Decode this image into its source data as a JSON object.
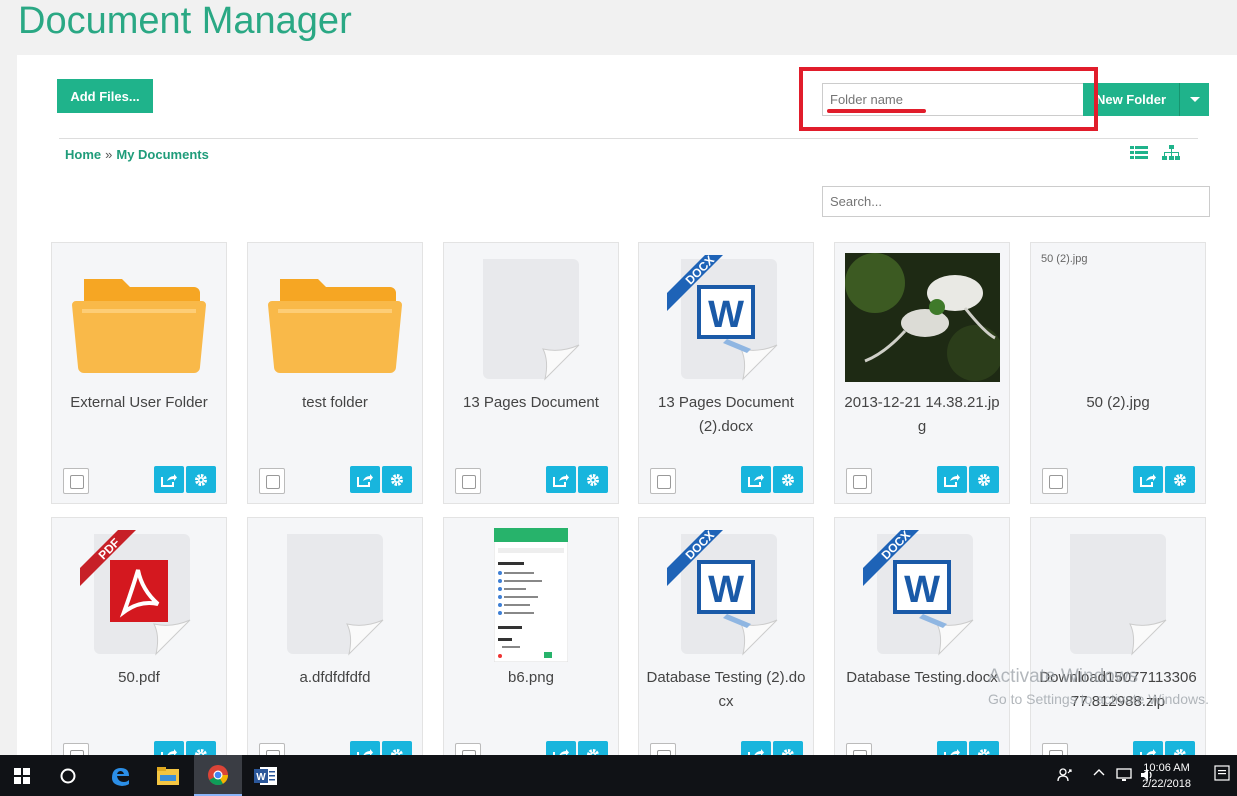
{
  "page_title": "Document Manager",
  "toolbar": {
    "add_files_label": "Add Files...",
    "folder_name_placeholder": "Folder name",
    "new_folder_label": "New Folder"
  },
  "breadcrumb": {
    "home": "Home",
    "separator": "»",
    "current": "My Documents"
  },
  "search": {
    "placeholder": "Search..."
  },
  "files": [
    {
      "name": "External User Folder",
      "icon": "folder-icon"
    },
    {
      "name": "test folder",
      "icon": "folder-icon"
    },
    {
      "name": "13 Pages Document",
      "icon": "blank-document-icon"
    },
    {
      "name": "13 Pages Document (2).docx",
      "icon": "docx-icon"
    },
    {
      "name": "2013-12-21 14.38.21.jpg",
      "icon": "image-thumbnail"
    },
    {
      "name": "50 (2).jpg",
      "icon": "broken-image-icon",
      "alt": "50 (2).jpg"
    },
    {
      "name": "50.pdf",
      "icon": "pdf-icon"
    },
    {
      "name": "a.dfdfdfdfd",
      "icon": "blank-document-icon"
    },
    {
      "name": "b6.png",
      "icon": "image-thumbnail"
    },
    {
      "name": "Database Testing (2).docx",
      "icon": "docx-icon"
    },
    {
      "name": "Database Testing.docx",
      "icon": "docx-icon"
    },
    {
      "name": "Download1507711330677.812988.zip",
      "icon": "blank-document-icon"
    }
  ],
  "badges": {
    "docx": "DOCX",
    "pdf": "PDF"
  },
  "watermark": {
    "line1": "Activate Windows",
    "line2": "Go to Settings to activate Windows."
  },
  "taskbar": {
    "time": "10:06 AM",
    "date": "2/22/2018"
  },
  "colors": {
    "accent": "#1fb38b",
    "action": "#18b5dd",
    "highlight": "#e11d2b"
  }
}
